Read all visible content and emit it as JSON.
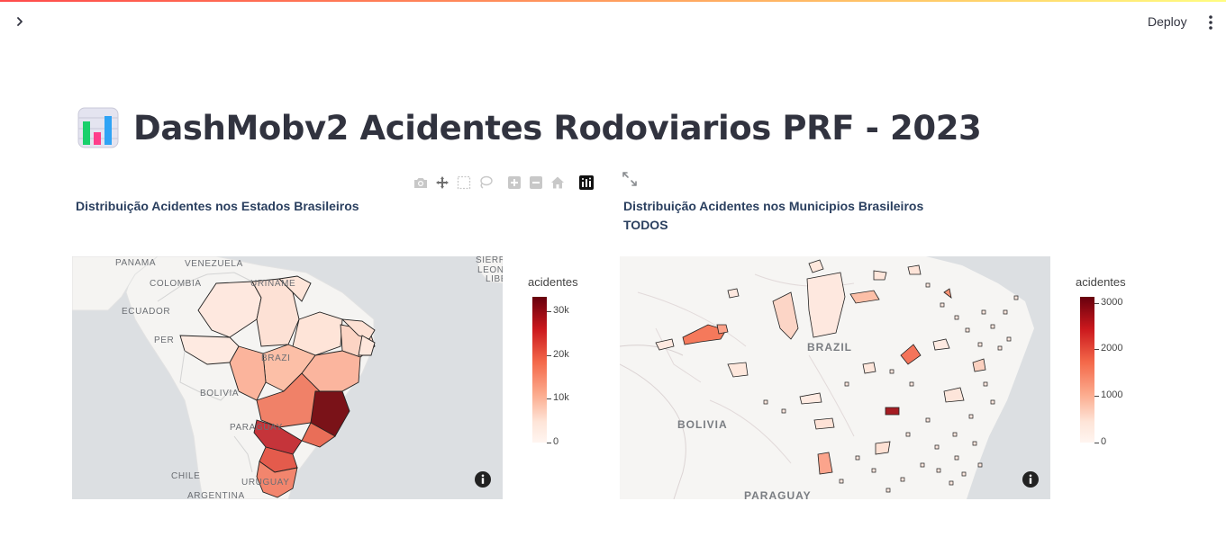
{
  "app": {
    "deploy_label": "Deploy",
    "title": "DashMobv2 Acidentes Rodoviarios PRF - 2023"
  },
  "charts": {
    "left": {
      "title": "Distribuição Acidentes nos Estados Brasileiros",
      "colorbar_title": "acidentes",
      "ticks": [
        "30k",
        "20k",
        "10k",
        "0"
      ],
      "labels": {
        "panama": "PANAMA",
        "venezuela": "VENEZUELA",
        "colombia": "COLOMBIA",
        "suriname": "URINAME",
        "ecuador": "ECUADOR",
        "peru": "PER",
        "brazil": "BRAZI",
        "bolivia": "BOLIVIA",
        "paraguay": "PARAGUAY",
        "chile": "CHILE",
        "uruguay": "URUGUAY",
        "argentina": "ARGENTINA",
        "sierra_leone_1": "SIERR",
        "sierra_leone_2": "LEON",
        "liberia": "LIBE"
      }
    },
    "right": {
      "title_line1": "Distribuição Acidentes nos Municipios Brasileiros",
      "title_line2": "TODOS",
      "colorbar_title": "acidentes",
      "ticks": [
        "3000",
        "2000",
        "1000",
        "0"
      ],
      "labels": {
        "brazil": "BRAZIL",
        "bolivia": "BOLIVIA",
        "paraguay": "PARAGUAY"
      }
    }
  },
  "chart_data": [
    {
      "type": "choropleth",
      "title": "Distribuição Acidentes nos Estados Brasileiros",
      "colorbar": {
        "title": "acidentes",
        "range": [
          0,
          33000
        ],
        "ticks": [
          "0",
          "10k",
          "20k",
          "30k"
        ]
      },
      "colorscale": "Reds"
    },
    {
      "type": "choropleth",
      "title": "Distribuição Acidentes nos Municipios Brasileiros TODOS",
      "colorbar": {
        "title": "acidentes",
        "range": [
          0,
          3200
        ],
        "ticks": [
          "0",
          "1000",
          "2000",
          "3000"
        ]
      },
      "colorscale": "Reds"
    }
  ]
}
